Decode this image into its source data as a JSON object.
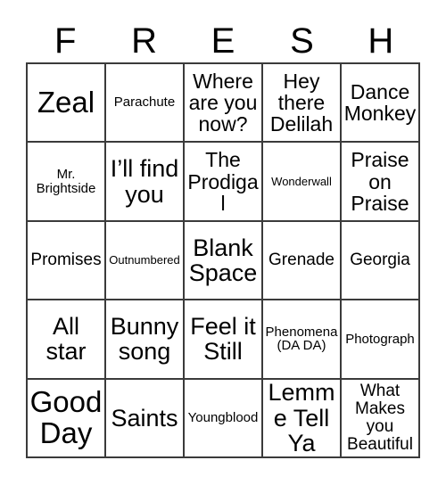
{
  "card": {
    "header_letters": [
      "F",
      "R",
      "E",
      "S",
      "H"
    ],
    "columns": 5,
    "rows": 5,
    "border_color": "#3b3b3b",
    "background_color": "#ffffff",
    "text_color": "#000000",
    "cells": [
      [
        {
          "text": "Zeal",
          "size": "xxl"
        },
        {
          "text": "Parachute",
          "size": "sm"
        },
        {
          "text": "Where are you now?",
          "size": "lg"
        },
        {
          "text": "Hey there Delilah",
          "size": "lg"
        },
        {
          "text": "Dance Monkey",
          "size": "lg"
        }
      ],
      [
        {
          "text": "Mr. Brightside",
          "size": "sm"
        },
        {
          "text": "I’ll find you",
          "size": "xl"
        },
        {
          "text": "The Prodigal",
          "size": "lg"
        },
        {
          "text": "Wonderwall",
          "size": "xs"
        },
        {
          "text": "Praise on Praise",
          "size": "lg"
        }
      ],
      [
        {
          "text": "Promises",
          "size": "md"
        },
        {
          "text": "Outnumbered",
          "size": "xs"
        },
        {
          "text": "Blank Space",
          "size": "xl"
        },
        {
          "text": "Grenade",
          "size": "md"
        },
        {
          "text": "Georgia",
          "size": "md"
        }
      ],
      [
        {
          "text": "All star",
          "size": "xl"
        },
        {
          "text": "Bunny song",
          "size": "xl"
        },
        {
          "text": "Feel it Still",
          "size": "xl"
        },
        {
          "text": "Phenomena (DA DA)",
          "size": "sm"
        },
        {
          "text": "Photograph",
          "size": "sm"
        }
      ],
      [
        {
          "text": "Good Day",
          "size": "xxl"
        },
        {
          "text": "Saints",
          "size": "xl"
        },
        {
          "text": "Youngblood",
          "size": "sm"
        },
        {
          "text": "Lemme Tell Ya",
          "size": "xl"
        },
        {
          "text": "What Makes you Beautiful",
          "size": "md"
        }
      ]
    ]
  }
}
